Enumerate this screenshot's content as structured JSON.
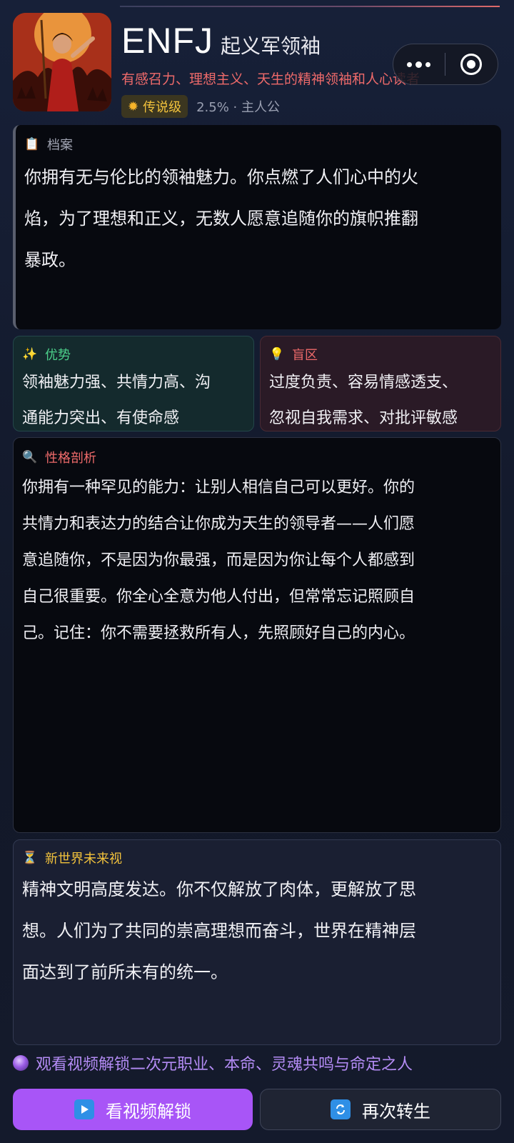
{
  "header": {
    "mbti": "ENFJ",
    "role": "起义军领袖",
    "tagline": "有感召力、理想主义、天生的精神领袖和人心读者",
    "rarity_label": "传说级",
    "meta": "2.5% · 主人公",
    "avatar_icon": "rebel-leader-avatar"
  },
  "capsule": {
    "more_icon": "more-dots-icon",
    "close_icon": "target-close-icon"
  },
  "file_card": {
    "title": "档案",
    "icon": "clipboard-icon",
    "lines": [
      "你拥有无与伦比的领袖魅力。你点燃了人们心中的火",
      "焰，为了理想和正义，无数人愿意追随你的旗帜推翻",
      "暴政。"
    ]
  },
  "advantages": {
    "title": "优势",
    "icon": "sparkles-icon",
    "lines": [
      "领袖魅力强、共情力高、沟",
      "通能力突出、有使命感"
    ]
  },
  "blindspots": {
    "title": "盲区",
    "icon": "lightbulb-icon",
    "lines": [
      "过度负责、容易情感透支、",
      "忽视自我需求、对批评敏感"
    ]
  },
  "analysis": {
    "title": "性格剖析",
    "icon": "magnifier-icon",
    "lines": [
      "你拥有一种罕见的能力：让别人相信自己可以更好。你的",
      "共情力和表达力的结合让你成为天生的领导者——人们愿",
      "意追随你，不是因为你最强，而是因为你让每个人都感到",
      "自己很重要。你全心全意为他人付出，但常常忘记照顾自",
      "己。记住：你不需要拯救所有人，先照顾好自己的内心。"
    ]
  },
  "future": {
    "title": "新世界未来视",
    "icon": "hourglass-icon",
    "lines": [
      "精神文明高度发达。你不仅解放了肉体，更解放了思",
      "想。人们为了共同的崇高理想而奋斗，世界在精神层",
      "面达到了前所未有的统一。"
    ]
  },
  "unlock_hint": "观看视频解锁二次元职业、本命、灵魂共鸣与命定之人",
  "buttons": {
    "watch_label": "看视频解锁",
    "rebirth_label": "再次转生"
  },
  "colors": {
    "accent_red": "#ee6a6a",
    "gold": "#f2c23c",
    "green": "#4cd08a",
    "purple": "#a855f7"
  }
}
